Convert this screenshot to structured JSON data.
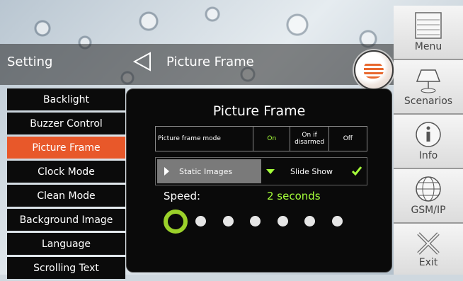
{
  "header": {
    "section_title": "Setting",
    "page_title": "Picture Frame"
  },
  "sidebar": {
    "items": [
      {
        "label": "Backlight"
      },
      {
        "label": "Buzzer Control"
      },
      {
        "label": "Picture Frame",
        "active": true
      },
      {
        "label": "Clock Mode"
      },
      {
        "label": "Clean Mode"
      },
      {
        "label": "Background Image"
      },
      {
        "label": "Language"
      },
      {
        "label": "Scrolling Text"
      }
    ]
  },
  "panel": {
    "title": "Picture Frame",
    "mode_row": {
      "label": "Picture frame mode",
      "options": [
        "On",
        "On if\ndisarmed",
        "Off"
      ],
      "selected": "On"
    },
    "slide": {
      "static_label": "Static Images",
      "slideshow_label": "Slide Show",
      "selected": "Slide Show"
    },
    "speed": {
      "label": "Speed:",
      "value": "2 seconds",
      "levels": 7,
      "selected_level": 1
    }
  },
  "right_menu": {
    "items": [
      {
        "label": "Menu",
        "icon": "menu-icon"
      },
      {
        "label": "Scenarios",
        "icon": "scenarios-icon"
      },
      {
        "label": "Info",
        "icon": "info-icon"
      },
      {
        "label": "GSM/IP",
        "icon": "globe-icon"
      },
      {
        "label": "Exit",
        "icon": "exit-icon"
      }
    ]
  },
  "colors": {
    "accent": "#e8582a",
    "highlight": "#a5ff3a",
    "panel_bg": "#0a0a0a"
  }
}
